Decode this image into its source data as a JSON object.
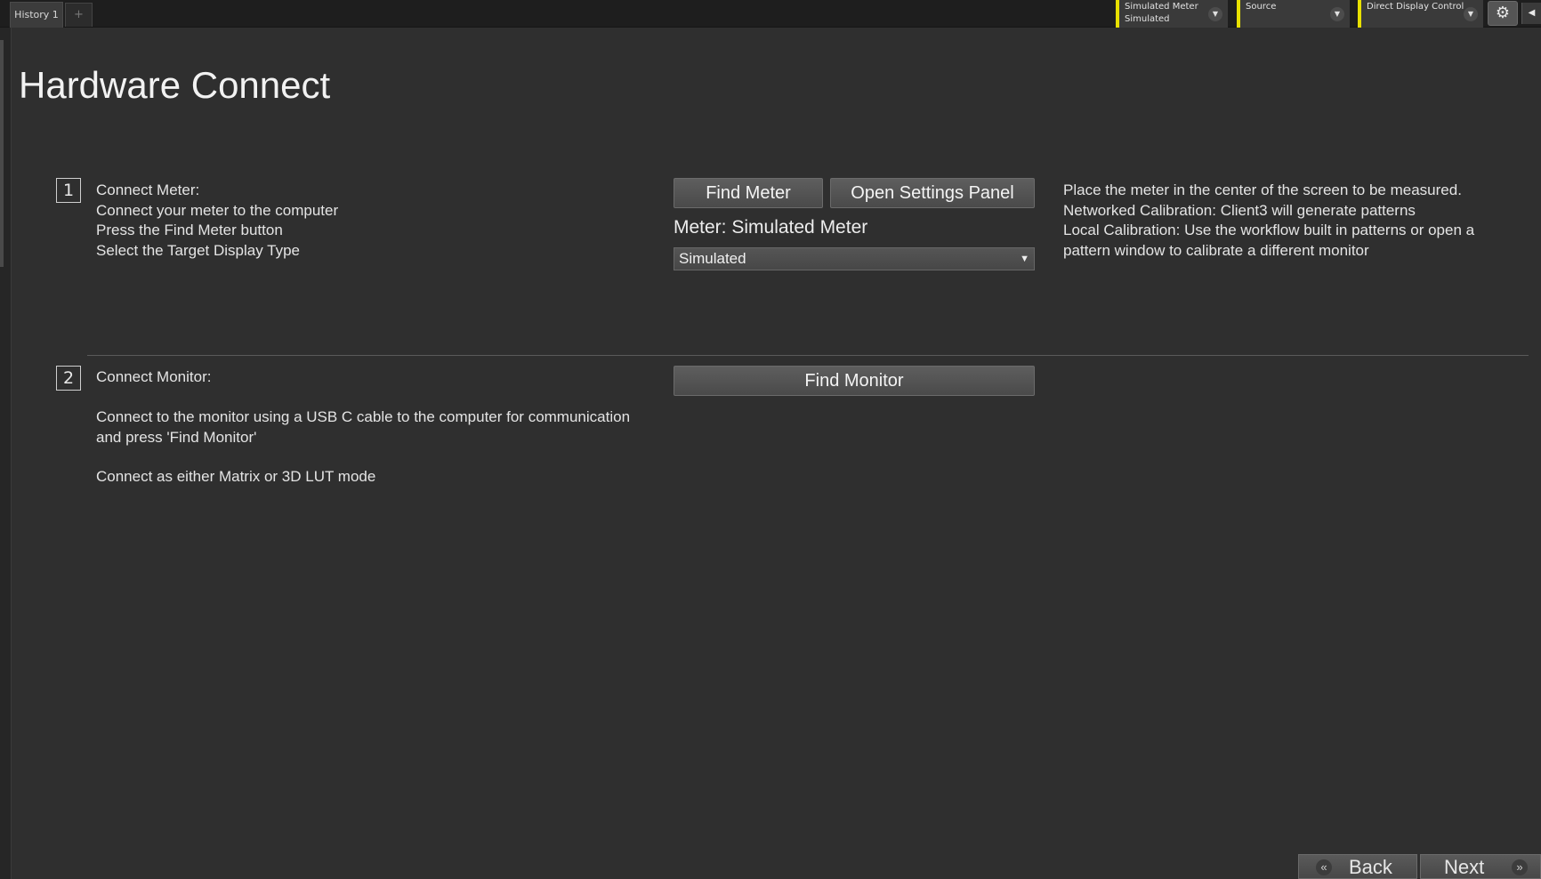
{
  "topbar": {
    "tabs": [
      {
        "label": "History 1"
      }
    ],
    "add_tab": "+",
    "dropdowns": [
      {
        "line1": "Simulated Meter",
        "line2": "Simulated"
      },
      {
        "line1": "Source",
        "line2": ""
      },
      {
        "line1": "Direct Display Control",
        "line2": ""
      }
    ],
    "accent_color": "#e8e000"
  },
  "page": {
    "title": "Hardware Connect"
  },
  "step1": {
    "number": "1",
    "lines": [
      "Connect Meter:",
      "Connect your meter to the computer",
      "Press the Find Meter button",
      "Select the Target Display Type"
    ],
    "find_meter_label": "Find Meter",
    "open_settings_label": "Open Settings Panel",
    "meter_label": "Meter: Simulated Meter",
    "display_type_value": "Simulated",
    "help_lines": [
      "Place the meter in the center of the screen to be measured.",
      "Networked Calibration: Client3 will generate patterns",
      "Local Calibration: Use the workflow built in patterns or open a",
      "pattern window to calibrate a different monitor"
    ]
  },
  "step2": {
    "number": "2",
    "heading": "Connect Monitor:",
    "desc_lines": [
      "Connect to the monitor using a USB C cable to the computer for communication",
      "and press 'Find Monitor'"
    ],
    "note": "Connect as either Matrix or 3D LUT mode",
    "find_monitor_label": "Find Monitor"
  },
  "nav": {
    "back_label": "Back",
    "next_label": "Next"
  }
}
